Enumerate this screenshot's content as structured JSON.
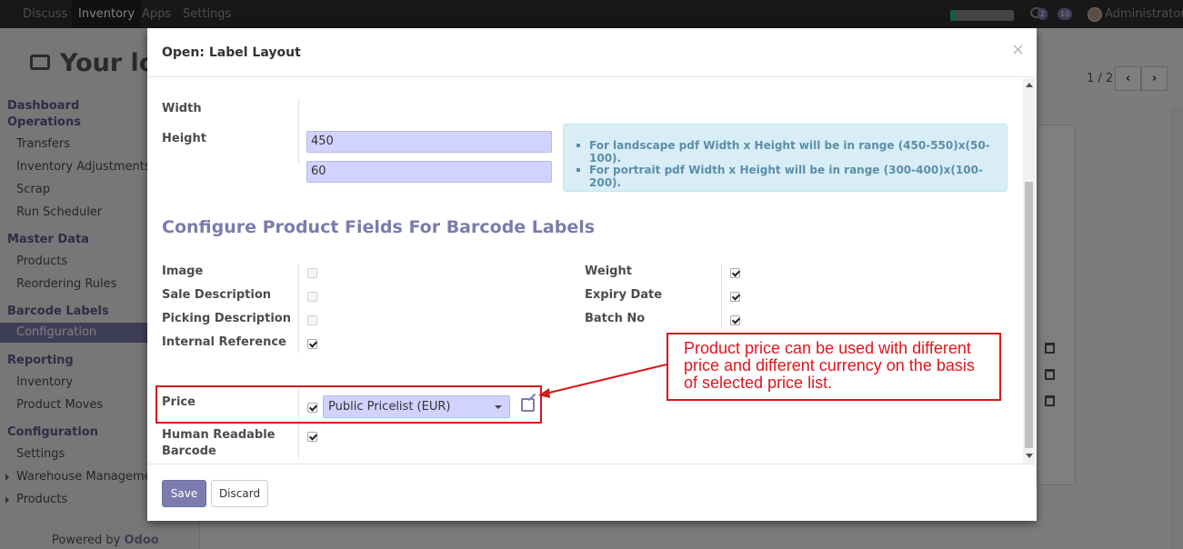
{
  "navbar": {
    "menus": [
      "Discuss",
      "Inventory",
      "Apps",
      "Settings"
    ],
    "active_menu": "Inventory",
    "chat_count": "2",
    "activity_count": "10",
    "user": "Administrator"
  },
  "background": {
    "logo_text": "Your log",
    "pager": "1 / 2",
    "sidebar": [
      {
        "type": "head",
        "label": "Dashboard"
      },
      {
        "type": "head",
        "label": "Operations"
      },
      {
        "type": "item",
        "label": "Transfers"
      },
      {
        "type": "item",
        "label": "Inventory Adjustments"
      },
      {
        "type": "item",
        "label": "Scrap"
      },
      {
        "type": "item",
        "label": "Run Scheduler"
      },
      {
        "type": "head",
        "label": "Master Data"
      },
      {
        "type": "item",
        "label": "Products"
      },
      {
        "type": "item",
        "label": "Reordering Rules"
      },
      {
        "type": "head",
        "label": "Barcode Labels"
      },
      {
        "type": "item",
        "label": "Configuration",
        "active": true
      },
      {
        "type": "head",
        "label": "Reporting"
      },
      {
        "type": "item",
        "label": "Inventory"
      },
      {
        "type": "item",
        "label": "Product Moves"
      },
      {
        "type": "head",
        "label": "Configuration"
      },
      {
        "type": "item",
        "label": "Settings"
      },
      {
        "type": "item",
        "label": "Warehouse Management"
      },
      {
        "type": "item",
        "label": "Products"
      }
    ],
    "powered_by": "Powered by",
    "powered_brand": "Odoo"
  },
  "dialog": {
    "title": "Open: Label Layout",
    "close_symbol": "×",
    "width_label": "Width",
    "width_value": "450",
    "height_label": "Height",
    "height_value": "60",
    "info_lines": [
      "For landscape pdf Width x Height will be in range (450-550)x(50-100).",
      "For portrait pdf Width x Height will be in range (300-400)x(100-200)."
    ],
    "section_title": "Configure Product Fields For Barcode Labels",
    "left_fields": [
      {
        "label": "Image",
        "checked": false
      },
      {
        "label": "Sale Description",
        "checked": false
      },
      {
        "label": "Picking Description",
        "checked": false
      },
      {
        "label": "Internal Reference",
        "checked": true
      }
    ],
    "right_fields": [
      {
        "label": "Weight",
        "checked": true
      },
      {
        "label": "Expiry Date",
        "checked": true
      },
      {
        "label": "Batch No",
        "checked": true
      }
    ],
    "price_label": "Price",
    "price_checked": true,
    "pricelist_value": "Public Pricelist (EUR)",
    "human_readable_label_1": "Human Readable",
    "human_readable_label_2": "Barcode",
    "human_readable_checked": true,
    "annotation": "Product price can be used with different price and different currency on the basis of selected price list.",
    "save_label": "Save",
    "discard_label": "Discard"
  },
  "colors": {
    "accent": "#7c7bad",
    "annotation_red": "#d41a1a",
    "input_bg": "#d2d2ff",
    "info_bg": "#d9edf7"
  }
}
